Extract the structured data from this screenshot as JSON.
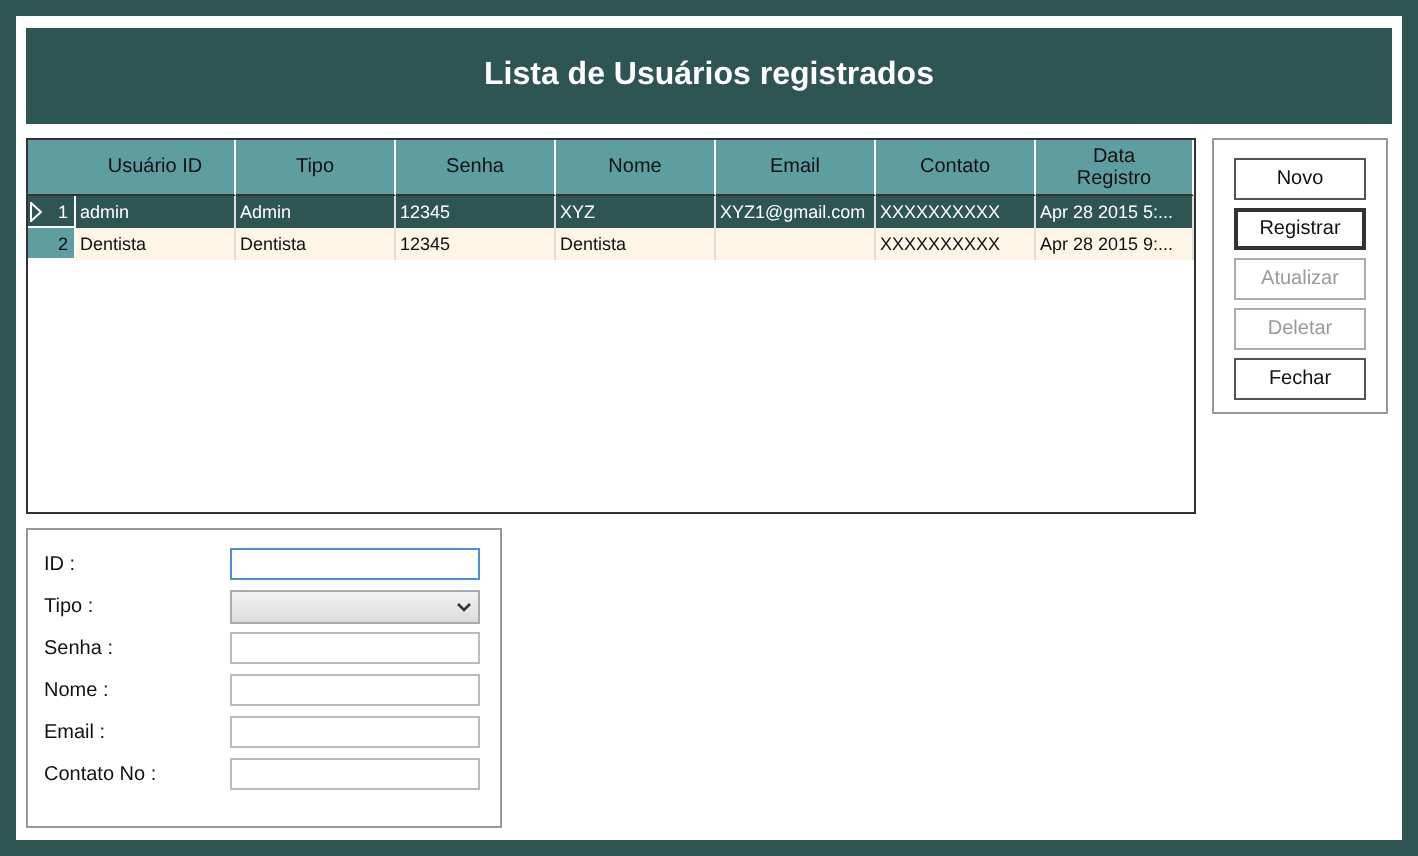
{
  "header": {
    "title": "Lista de Usuários registrados"
  },
  "table": {
    "columns": [
      "Usuário ID",
      "Tipo",
      "Senha",
      "Nome",
      "Email",
      "Contato",
      "Data Registro"
    ],
    "rows": [
      {
        "number": "1",
        "selected": true,
        "cells": [
          "admin",
          "Admin",
          "12345",
          "XYZ",
          "XYZ1@gmail.com",
          "XXXXXXXXXX",
          "Apr 28 2015  5:..."
        ]
      },
      {
        "number": "2",
        "selected": false,
        "cells": [
          "Dentista",
          "Dentista",
          "12345",
          "Dentista",
          "",
          "XXXXXXXXXX",
          "Apr 28 2015  9:..."
        ]
      }
    ]
  },
  "buttons": [
    {
      "label": "Novo",
      "disabled": false,
      "focused": false
    },
    {
      "label": "Registrar",
      "disabled": false,
      "focused": true
    },
    {
      "label": "Atualizar",
      "disabled": true,
      "focused": false
    },
    {
      "label": "Deletar",
      "disabled": true,
      "focused": false
    },
    {
      "label": "Fechar",
      "disabled": false,
      "focused": false
    }
  ],
  "form": [
    {
      "label": "ID :",
      "kind": "input",
      "focused": true
    },
    {
      "label": "Tipo :",
      "kind": "select",
      "focused": false
    },
    {
      "label": "Senha :",
      "kind": "input",
      "focused": false
    },
    {
      "label": "Nome :",
      "kind": "input",
      "focused": false
    },
    {
      "label": "Email :",
      "kind": "input",
      "focused": false
    },
    {
      "label": "Contato No :",
      "kind": "input",
      "focused": false
    }
  ]
}
